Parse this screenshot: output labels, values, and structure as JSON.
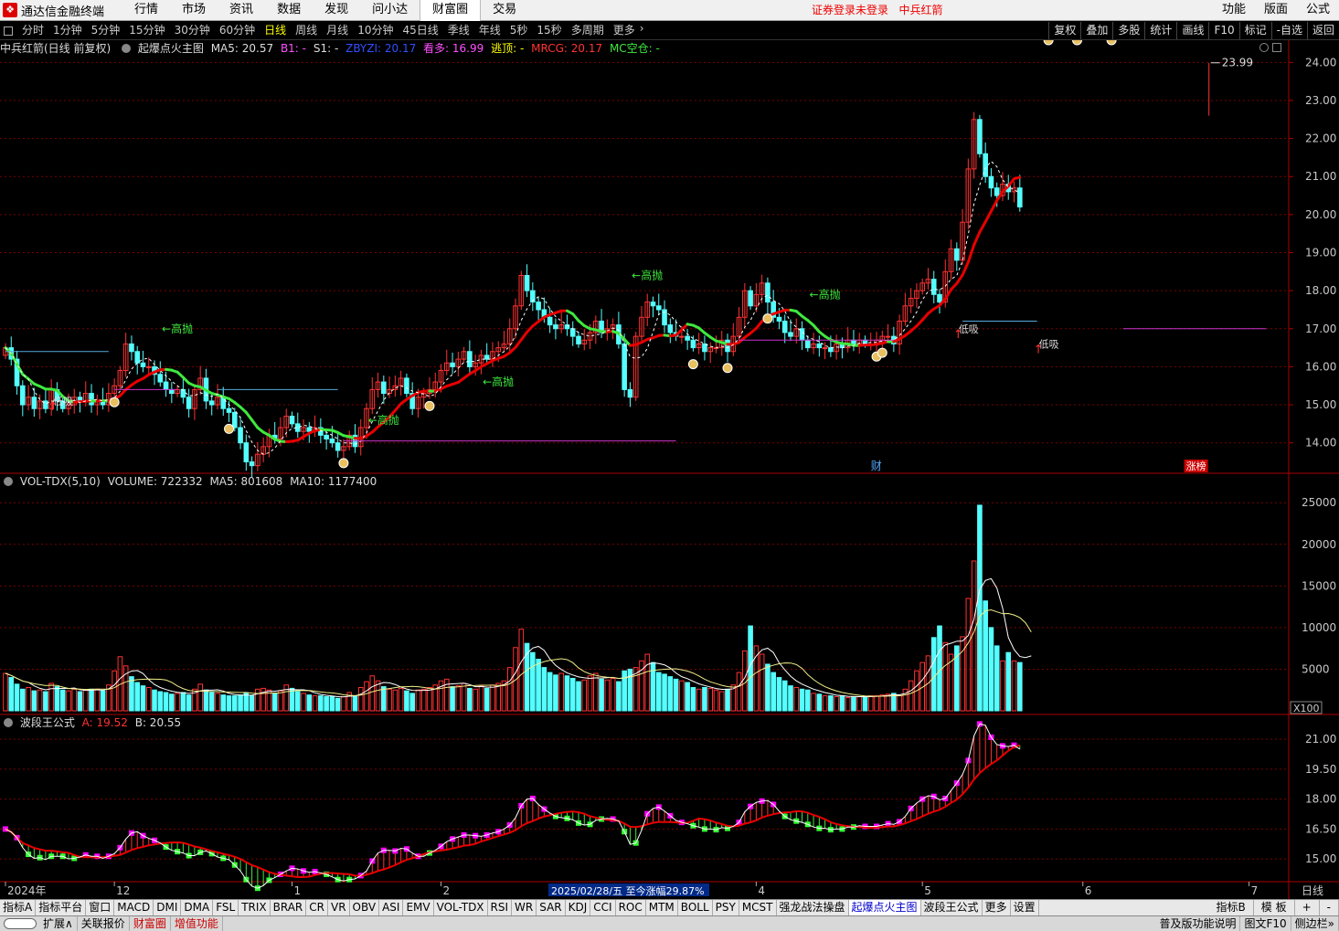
{
  "app": {
    "name": "通达信金融终端",
    "notice": "证券登录未登录",
    "stock": "中兵红箭"
  },
  "menu": [
    "行情",
    "市场",
    "资讯",
    "数据",
    "发现",
    "问小达",
    "财富圈",
    "交易"
  ],
  "menu_active": "财富圈",
  "right_menu": [
    "功能",
    "版面",
    "公式"
  ],
  "periods": [
    "分时",
    "1分钟",
    "5分钟",
    "15分钟",
    "30分钟",
    "60分钟",
    "日线",
    "周线",
    "月线",
    "10分钟",
    "45日线",
    "季线",
    "年线",
    "5秒",
    "15秒",
    "多周期",
    "更多"
  ],
  "period_active": "日线",
  "right_tools": [
    "复权",
    "叠加",
    "多股",
    "统计",
    "画线",
    "F10",
    "标记",
    "-自选",
    "返回"
  ],
  "main_panel": {
    "title": "中兵红箭(日线 前复权)",
    "indicator": "起爆点火主图",
    "ma5": "MA5: 20.57",
    "b1": "B1: -",
    "s1": "S1: -",
    "zbyzi": "ZBYZI: 20.17",
    "kanduo": "看多: 16.99",
    "taoding": "逃顶: -",
    "mrcg": "MRCG: 20.17",
    "mckongcang": "MC空仓: -",
    "high_label": "23.99",
    "price_axis": [
      "24.00",
      "23.00",
      "22.00",
      "21.00",
      "20.00",
      "19.00",
      "18.00",
      "17.00",
      "16.00",
      "15.00",
      "14.00"
    ],
    "labels": {
      "gaopao": "高抛",
      "dixi": "低吸",
      "cai": "财",
      "zhangbang": "涨榜"
    }
  },
  "volume_panel": {
    "name": "VOL-TDX(5,10)",
    "volume": "VOLUME: 722332",
    "ma5": "MA5: 801608",
    "ma10": "MA10: 1177400",
    "axis": [
      "25000",
      "20000",
      "15000",
      "10000",
      "5000"
    ],
    "unit": "X100"
  },
  "wave_panel": {
    "name": "波段王公式",
    "a": "A: 19.52",
    "b": "B: 20.55",
    "axis": [
      "21.00",
      "19.50",
      "18.00",
      "16.50",
      "15.00"
    ]
  },
  "date_axis": {
    "labels": [
      {
        "t": "2024年",
        "i": 0
      },
      {
        "t": "12",
        "i": 19
      },
      {
        "t": "1",
        "i": 50
      },
      {
        "t": "2",
        "i": 76
      },
      {
        "t": "4",
        "i": 131
      },
      {
        "t": "5",
        "i": 160
      },
      {
        "t": "6",
        "i": 188
      },
      {
        "t": "7",
        "i": 217
      }
    ],
    "highlight": "2025/02/28/五  至今涨幅29.87%",
    "period": "日线"
  },
  "tabs_row1": [
    "指标A",
    "指标平台",
    "窗口",
    "MACD",
    "DMI",
    "DMA",
    "FSL",
    "TRIX",
    "BRAR",
    "CR",
    "VR",
    "OBV",
    "ASI",
    "EMV",
    "VOL-TDX",
    "RSI",
    "WR",
    "SAR",
    "KDJ",
    "CCI",
    "ROC",
    "MTM",
    "BOLL",
    "PSY",
    "MCST",
    "强龙战法操盘",
    "起爆点火主图",
    "波段王公式",
    "更多",
    "设置"
  ],
  "tabs_row1_active": "起爆点火主图",
  "tabs_row1_right": [
    "指标B",
    "模 板",
    "+",
    "-"
  ],
  "tabs_row2": [
    "扩展∧",
    "关联报价",
    "财富圈",
    "增值功能"
  ],
  "tabs_row2_right": [
    "普及版功能说明",
    "图文F10",
    "侧边栏»"
  ],
  "colors": {
    "up": "#ff3232",
    "down": "#54ffff",
    "ma_red": "#e80000",
    "ma_green": "#3fe83f",
    "grid": "#7a0000",
    "axis_text": "#c8c8c8"
  },
  "chart_data": {
    "type": "candlestick",
    "title": "中兵红箭(日线 前复权)",
    "y_range": [
      13.2,
      24.2
    ],
    "high_marker": 23.99,
    "closes": [
      16.5,
      16.2,
      15.5,
      15.0,
      15.2,
      14.9,
      15.1,
      14.9,
      15.4,
      15.1,
      14.9,
      15.0,
      15.2,
      15.1,
      15.3,
      15.0,
      15.1,
      15.0,
      15.3,
      15.5,
      15.9,
      16.6,
      16.4,
      16.1,
      16.0,
      16.0,
      15.8,
      15.6,
      15.4,
      15.3,
      15.4,
      15.2,
      14.9,
      15.4,
      15.7,
      15.1,
      15.0,
      15.2,
      14.9,
      14.8,
      14.4,
      14.0,
      13.5,
      13.4,
      13.7,
      13.9,
      14.2,
      14.1,
      14.4,
      14.7,
      14.5,
      14.3,
      14.4,
      14.3,
      14.4,
      14.2,
      14.1,
      14.0,
      13.8,
      13.9,
      14.2,
      13.9,
      14.4,
      14.9,
      15.4,
      15.6,
      15.3,
      15.4,
      15.5,
      15.7,
      15.3,
      14.9,
      15.2,
      15.3,
      15.4,
      15.6,
      15.9,
      16.1,
      16.0,
      16.2,
      16.4,
      16.0,
      16.1,
      16.3,
      16.2,
      16.4,
      16.5,
      16.6,
      17.0,
      17.6,
      18.4,
      18.0,
      17.7,
      17.5,
      17.3,
      17.1,
      17.0,
      17.1,
      17.0,
      16.8,
      16.6,
      16.7,
      16.9,
      17.2,
      16.9,
      17.0,
      17.1,
      16.6,
      15.4,
      15.2,
      16.8,
      17.3,
      17.7,
      17.6,
      17.5,
      17.1,
      16.9,
      16.8,
      16.8,
      16.7,
      16.5,
      16.6,
      16.4,
      16.5,
      16.5,
      16.7,
      16.4,
      16.8,
      17.3,
      18.0,
      17.6,
      17.9,
      18.2,
      17.7,
      17.3,
      17.2,
      16.9,
      16.8,
      17.0,
      16.7,
      16.5,
      16.6,
      16.5,
      16.5,
      16.4,
      16.6,
      16.5,
      16.7,
      16.6,
      16.7,
      16.6,
      16.6,
      16.7,
      16.8,
      16.8,
      16.6,
      17.2,
      17.6,
      17.8,
      18.0,
      18.2,
      18.3,
      17.9,
      17.7,
      18.5,
      19.1,
      18.8,
      19.8,
      21.2,
      22.5,
      21.6,
      21.0,
      20.7,
      20.5,
      20.8,
      20.6,
      20.7,
      20.2
    ],
    "volume": [
      4500,
      4000,
      3200,
      2600,
      2800,
      2400,
      2500,
      2300,
      3300,
      2900,
      2500,
      2400,
      2600,
      2300,
      2500,
      2600,
      2600,
      2400,
      3100,
      4800,
      6500,
      5400,
      4100,
      3400,
      3000,
      2800,
      2500,
      2300,
      2200,
      2000,
      2100,
      2200,
      1900,
      2600,
      3200,
      2500,
      2200,
      2100,
      1900,
      1800,
      1800,
      1900,
      2100,
      1800,
      2600,
      2700,
      2500,
      2100,
      2400,
      3100,
      2700,
      2300,
      2100,
      1900,
      1800,
      1800,
      1700,
      1700,
      1500,
      1700,
      2200,
      1800,
      2800,
      3500,
      4200,
      3600,
      2900,
      2600,
      2500,
      2700,
      2400,
      2100,
      2500,
      2600,
      2800,
      3100,
      3600,
      3800,
      2900,
      3000,
      3300,
      2700,
      2600,
      3000,
      2700,
      3100,
      3300,
      3600,
      5200,
      7600,
      9800,
      8100,
      7000,
      6200,
      5200,
      4600,
      4300,
      4500,
      4200,
      3900,
      3500,
      3700,
      4200,
      4500,
      3800,
      3700,
      3900,
      3500,
      4800,
      5000,
      5200,
      6000,
      6800,
      5800,
      4600,
      4400,
      4100,
      3800,
      3600,
      3400,
      2800,
      2600,
      2800,
      2700,
      2500,
      2300,
      2600,
      3100,
      4600,
      7200,
      10200,
      7800,
      6800,
      5600,
      4600,
      4000,
      3600,
      3000,
      2800,
      2600,
      2500,
      2100,
      2000,
      1800,
      1800,
      1700,
      1800,
      1600,
      1700,
      1700,
      1700,
      1800,
      1800,
      1900,
      2000,
      2100,
      1800,
      2600,
      3600,
      4800,
      5800,
      6600,
      8800,
      10200,
      8200,
      6800,
      7800,
      8900,
      13500,
      18000,
      24700,
      13200,
      10000,
      7800,
      6000,
      7000,
      6000,
      5800,
      7200,
      7000
    ],
    "note": "values estimated from chart"
  }
}
